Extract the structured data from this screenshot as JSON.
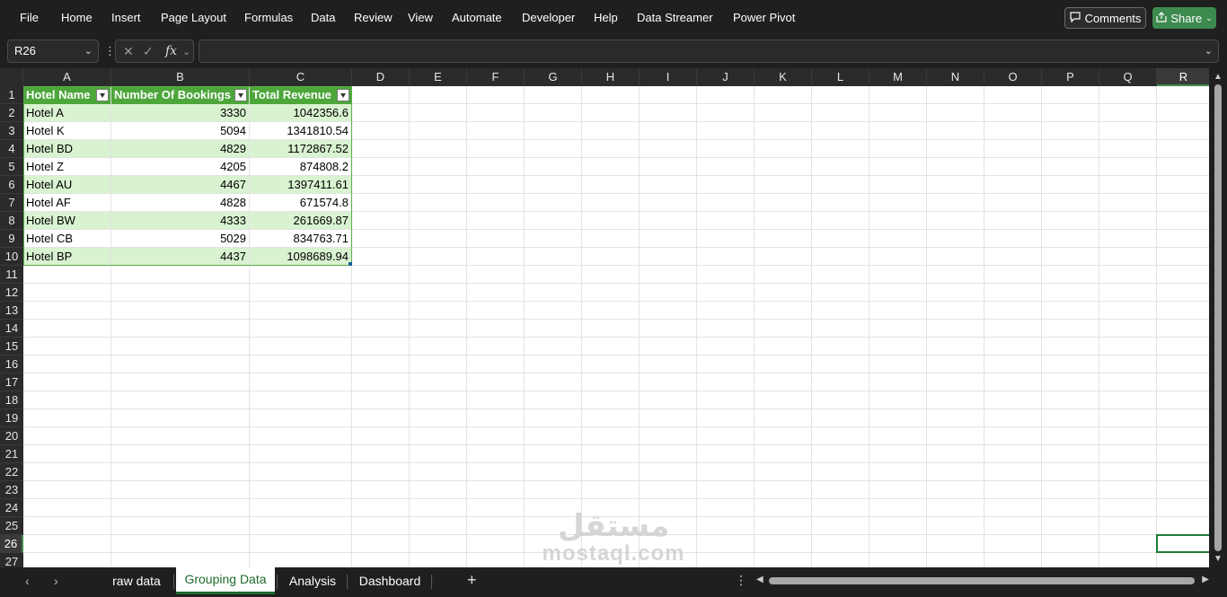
{
  "menu": {
    "items": [
      "File",
      "Home",
      "Insert",
      "Page Layout",
      "Formulas",
      "Data",
      "Review",
      "View",
      "Automate",
      "Developer",
      "Help",
      "Data Streamer",
      "Power Pivot"
    ],
    "comments_label": "Comments",
    "share_label": "Share"
  },
  "formula_bar": {
    "name_box": "R26",
    "fx_label": "fx",
    "formula": ""
  },
  "columns": [
    "A",
    "B",
    "C",
    "D",
    "E",
    "F",
    "G",
    "H",
    "I",
    "J",
    "K",
    "L",
    "M",
    "N",
    "O",
    "P",
    "Q",
    "R"
  ],
  "rows": [
    "1",
    "2",
    "3",
    "4",
    "5",
    "6",
    "7",
    "8",
    "9",
    "10",
    "11",
    "12",
    "13",
    "14",
    "15",
    "16",
    "17",
    "18",
    "19",
    "20",
    "21",
    "22",
    "23",
    "24",
    "25",
    "26",
    "27"
  ],
  "selected_column": "R",
  "selected_row": "26",
  "table": {
    "headers": [
      "Hotel Name",
      "Number Of Bookings",
      "Total Revenue"
    ],
    "rows": [
      [
        "Hotel A",
        "3330",
        "1042356.6"
      ],
      [
        "Hotel K",
        "5094",
        "1341810.54"
      ],
      [
        "Hotel BD",
        "4829",
        "1172867.52"
      ],
      [
        "Hotel Z",
        "4205",
        "874808.2"
      ],
      [
        "Hotel AU",
        "4467",
        "1397411.61"
      ],
      [
        "Hotel AF",
        "4828",
        "671574.8"
      ],
      [
        "Hotel BW",
        "4333",
        "261669.87"
      ],
      [
        "Hotel CB",
        "5029",
        "834763.71"
      ],
      [
        "Hotel BP",
        "4437",
        "1098689.94"
      ]
    ]
  },
  "watermark": {
    "arabic": "مستقل",
    "latin": "mostaql.com"
  },
  "sheets": {
    "tabs": [
      "raw data",
      "Grouping Data",
      "Analysis",
      "Dashboard"
    ],
    "active": "Grouping Data"
  },
  "colors": {
    "header_green": "#4ca63a",
    "band_green": "#d9f2d0",
    "accent": "#1e6b2e",
    "share_button": "#3d8a4f"
  }
}
